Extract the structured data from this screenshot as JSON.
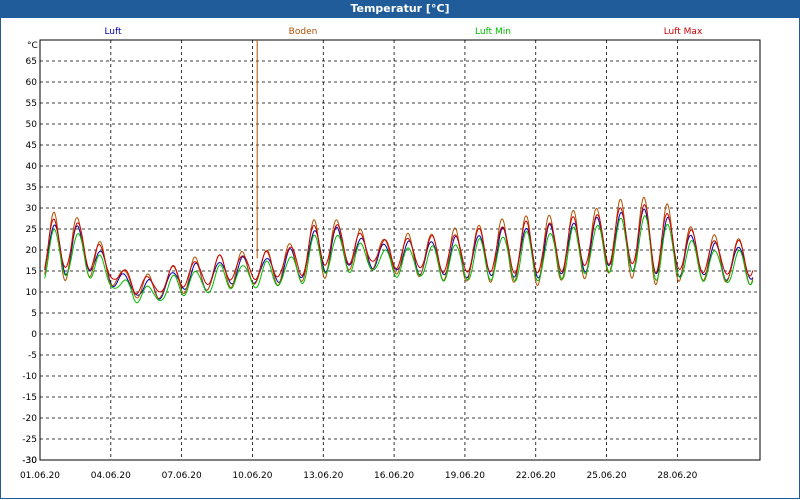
{
  "window": {
    "title": "Temperatur [°C]"
  },
  "chart_data": {
    "type": "line",
    "unit_label": "°C",
    "y_ticks": [
      65,
      60,
      55,
      50,
      45,
      40,
      35,
      30,
      25,
      20,
      15,
      10,
      5,
      0,
      -5,
      -10,
      -15,
      -20,
      -25,
      -30
    ],
    "ylim": [
      -30,
      70
    ],
    "x_labels": [
      "01.06.20",
      "04.06.20",
      "07.06.20",
      "10.06.20",
      "13.06.20",
      "16.06.20",
      "19.06.20",
      "22.06.20",
      "25.06.20",
      "28.06.20"
    ],
    "x_range_days": [
      0,
      30.5
    ],
    "grid": true,
    "legend_position": "top",
    "event_marker_day": 9.2,
    "daily_mean": [
      19.5,
      20.5,
      20,
      14,
      11,
      10.5,
      13.5,
      13.5,
      15,
      15,
      15.5,
      17,
      21,
      20,
      19,
      18,
      18.5,
      18,
      18.5,
      19,
      19.5,
      19.5,
      20,
      21,
      22,
      22.5,
      22,
      20,
      18,
      17
    ],
    "daily_amplitude": [
      6,
      6,
      5,
      2,
      2,
      2,
      3,
      3,
      3,
      3,
      3,
      4,
      6,
      4,
      3,
      3,
      4,
      4,
      5,
      5,
      6,
      6,
      6,
      6,
      6,
      7,
      8,
      6,
      4,
      4
    ],
    "series": [
      {
        "name": "Luft",
        "color": "#0000aa",
        "offset": 0,
        "amp_scale": 1.0,
        "phase_shift": 0.0
      },
      {
        "name": "Boden",
        "color": "#b05000",
        "offset": 0.5,
        "amp_scale": 1.35,
        "phase_shift": 0.02
      },
      {
        "name": "Luft Min",
        "color": "#00bb00",
        "offset": -1.2,
        "amp_scale": 0.95,
        "phase_shift": -0.01
      },
      {
        "name": "Luft Max",
        "color": "#cc0000",
        "offset": 1.0,
        "amp_scale": 1.0,
        "phase_shift": 0.01
      }
    ]
  }
}
